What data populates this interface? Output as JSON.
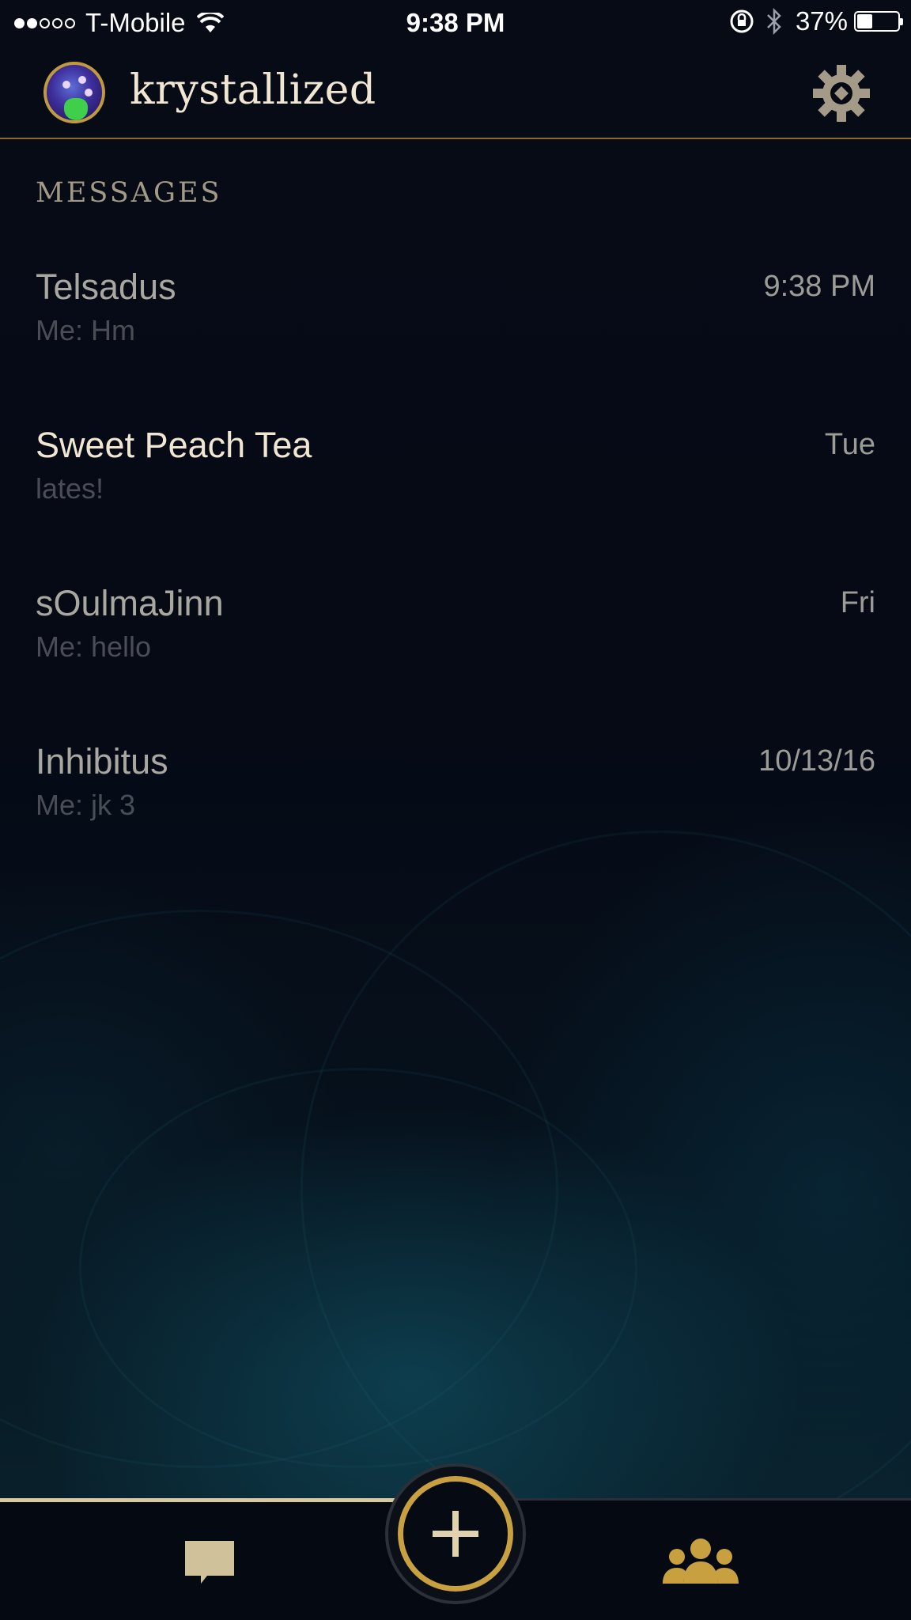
{
  "status_bar": {
    "carrier": "T-Mobile",
    "time": "9:38 PM",
    "battery": "37%",
    "battery_level": 0.37,
    "signal_bars_filled": 2,
    "signal_bars_total": 5
  },
  "header": {
    "username": "krystallized"
  },
  "messages": {
    "section_title": "MESSAGES",
    "items": [
      {
        "name": "Telsadus",
        "time": "9:38 PM",
        "preview": "Me: Hm",
        "unread": false
      },
      {
        "name": "Sweet Peach Tea",
        "time": "Tue",
        "preview": "lates!",
        "unread": true
      },
      {
        "name": "sOulmaJinn",
        "time": "Fri",
        "preview": "Me: hello",
        "unread": false
      },
      {
        "name": "Inhibitus",
        "time": "10/13/16",
        "preview": "Me: jk 3",
        "unread": false
      }
    ]
  },
  "bottom_nav": {
    "tabs": [
      "chat-icon",
      "add-icon",
      "friends-icon"
    ],
    "active_tab": "chat-icon"
  },
  "colors": {
    "gold_accent": "#c8a040",
    "text_light": "#f0e6d2",
    "background": "#050a14"
  }
}
